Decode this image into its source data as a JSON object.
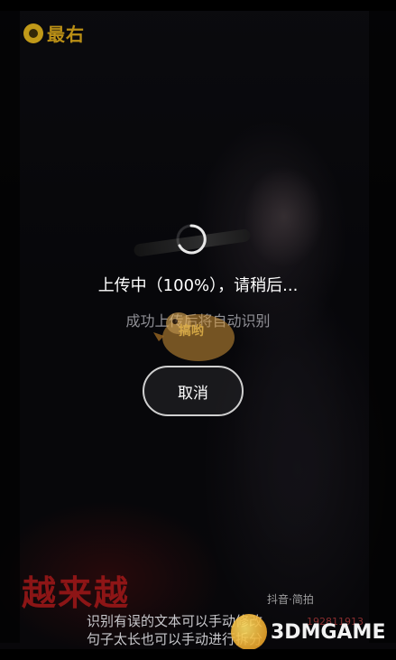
{
  "app": {
    "logo_text": "最右"
  },
  "upload": {
    "title": "上传中（100%），请稍后...",
    "subtitle": "成功上传后将自动识别",
    "cancel_label": "取消"
  },
  "video_overlay": {
    "red_caption": "越来越",
    "douyin_tag": "抖音·简拍",
    "douyin_id": "192811913",
    "mascot_text": "搞哟"
  },
  "hints": {
    "line1": "识别有误的文本可以手动修改",
    "line2": "句子太长也可以手动进行拆分"
  },
  "watermark": {
    "site_text": "3DMGAME"
  },
  "colors": {
    "accent": "#d9a718",
    "primary_text": "#ffffff",
    "secondary_text": "#8f8f95"
  }
}
